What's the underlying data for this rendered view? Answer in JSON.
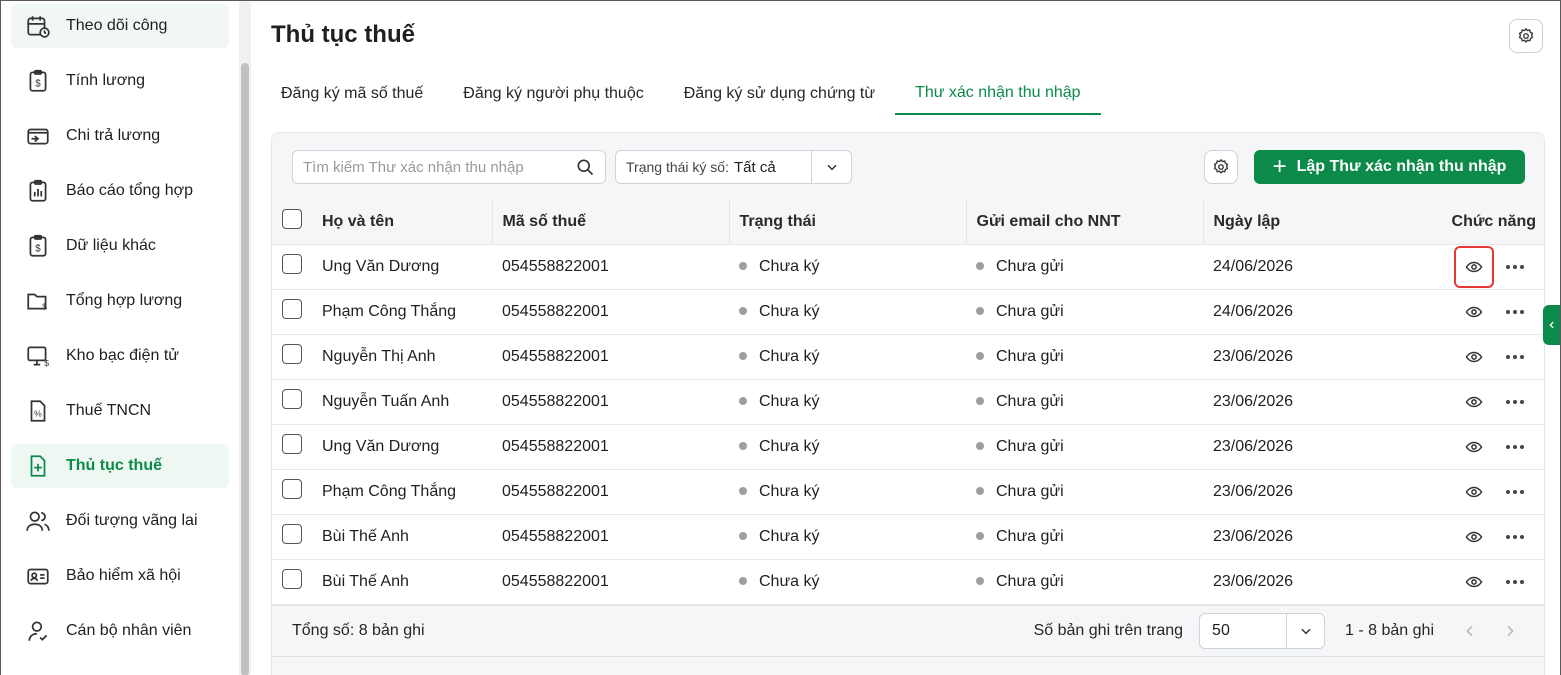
{
  "sidebar": {
    "items": [
      {
        "label": "Theo dõi công",
        "icon": "calendar-clock-icon"
      },
      {
        "label": "Tính lương",
        "icon": "payroll-clipboard-icon"
      },
      {
        "label": "Chi trả lương",
        "icon": "transfer-card-icon"
      },
      {
        "label": "Báo cáo tổng hợp",
        "icon": "report-clipboard-icon"
      },
      {
        "label": "Dữ liệu khác",
        "icon": "data-clipboard-icon"
      },
      {
        "label": "Tổng hợp lương",
        "icon": "salary-folder-icon"
      },
      {
        "label": "Kho bạc điện tử",
        "icon": "treasury-monitor-icon"
      },
      {
        "label": "Thuế TNCN",
        "icon": "tax-percent-icon"
      },
      {
        "label": "Thủ tục thuế",
        "icon": "tax-procedure-icon"
      },
      {
        "label": "Đối tượng vãng lai",
        "icon": "people-icon"
      },
      {
        "label": "Bảo hiểm xã hội",
        "icon": "insurance-card-icon"
      },
      {
        "label": "Cán bộ nhân viên",
        "icon": "employee-icon"
      }
    ],
    "active_index": 8
  },
  "page": {
    "title": "Thủ tục thuế"
  },
  "tabs": [
    {
      "label": "Đăng ký mã số thuế"
    },
    {
      "label": "Đăng ký người phụ thuộc"
    },
    {
      "label": "Đăng ký sử dụng chứng từ"
    },
    {
      "label": "Thư xác nhận thu nhập"
    }
  ],
  "toolbar": {
    "search_placeholder": "Tìm kiếm Thư xác nhận thu nhập",
    "filter_label": "Trạng thái ký số:",
    "filter_value": "Tất cả",
    "create_label": "Lập Thư xác nhận thu nhập"
  },
  "table": {
    "headers": {
      "name": "Họ và tên",
      "tax_code": "Mã số thuế",
      "status": "Trạng thái",
      "email": "Gửi email cho NNT",
      "date": "Ngày lập",
      "actions": "Chức năng"
    },
    "rows": [
      {
        "name": "Ung Văn Dương",
        "tax_code": "054558822001",
        "status": "Chưa ký",
        "email": "Chưa gửi",
        "date": "24/06/2026"
      },
      {
        "name": "Phạm Công Thắng",
        "tax_code": "054558822001",
        "status": "Chưa ký",
        "email": "Chưa gửi",
        "date": "24/06/2026"
      },
      {
        "name": "Nguyễn Thị Anh",
        "tax_code": "054558822001",
        "status": "Chưa ký",
        "email": "Chưa gửi",
        "date": "23/06/2026"
      },
      {
        "name": "Nguyễn Tuấn Anh",
        "tax_code": "054558822001",
        "status": "Chưa ký",
        "email": "Chưa gửi",
        "date": "23/06/2026"
      },
      {
        "name": "Ung Văn Dương",
        "tax_code": "054558822001",
        "status": "Chưa ký",
        "email": "Chưa gửi",
        "date": "23/06/2026"
      },
      {
        "name": "Phạm Công Thắng",
        "tax_code": "054558822001",
        "status": "Chưa ký",
        "email": "Chưa gửi",
        "date": "23/06/2026"
      },
      {
        "name": "Bùi Thế Anh",
        "tax_code": "054558822001",
        "status": "Chưa ký",
        "email": "Chưa gửi",
        "date": "23/06/2026"
      },
      {
        "name": "Bùi Thế Anh",
        "tax_code": "054558822001",
        "status": "Chưa ký",
        "email": "Chưa gửi",
        "date": "23/06/2026"
      }
    ]
  },
  "footer": {
    "total": "Tổng số: 8 bản ghi",
    "per_page_label": "Số bản ghi trên trang",
    "per_page_value": "50",
    "range": "1 - 8 bản ghi"
  },
  "colors": {
    "accent": "#0b8a4a",
    "highlight": "#e53935"
  }
}
